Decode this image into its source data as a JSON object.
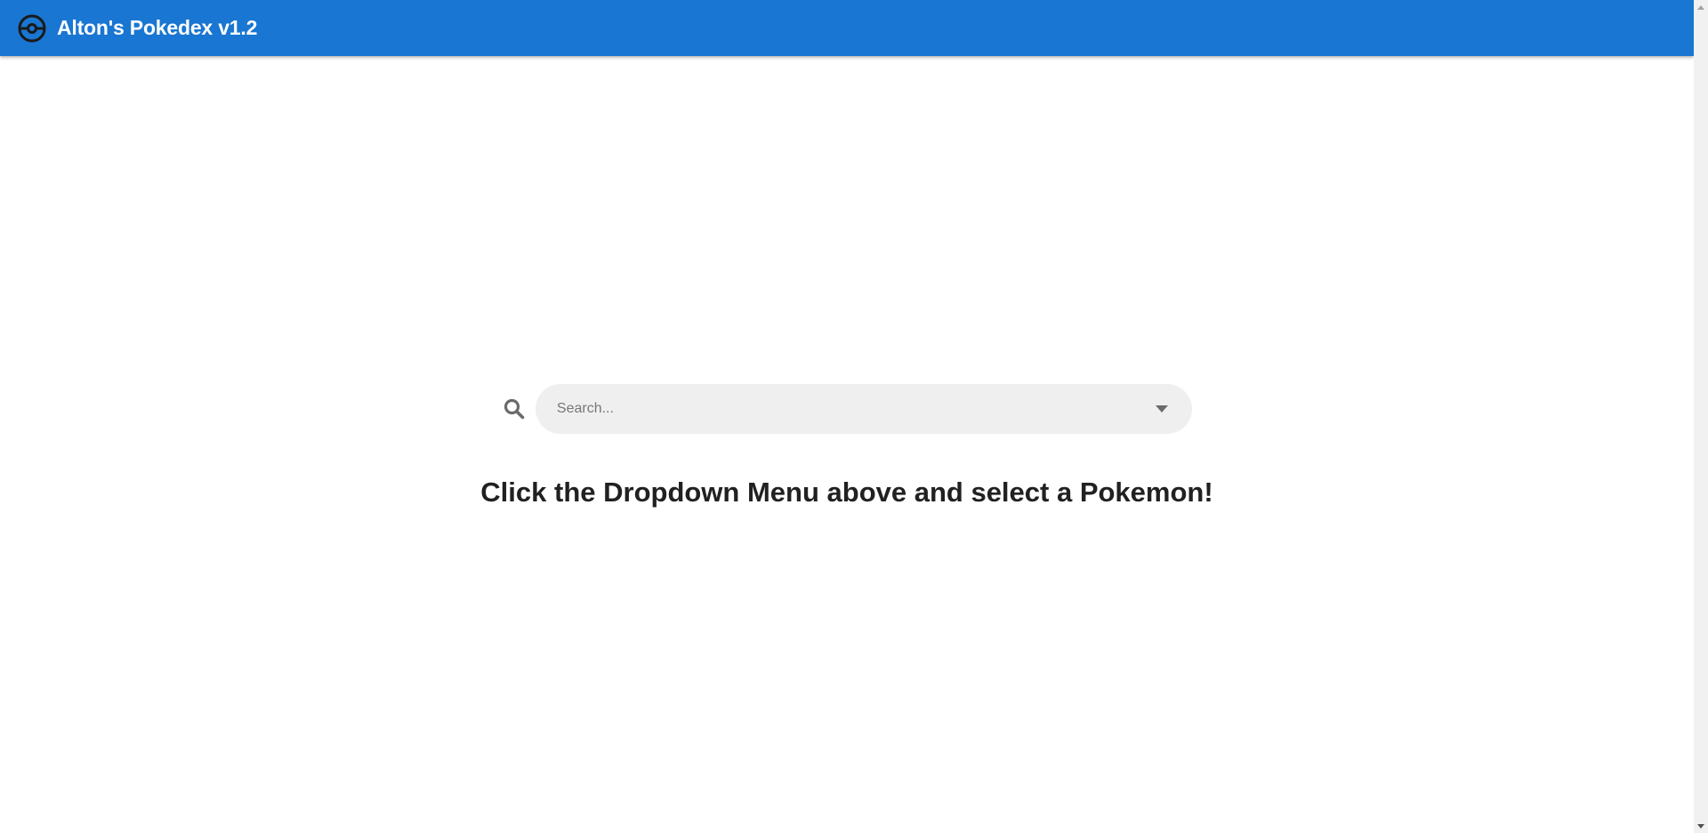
{
  "app": {
    "title": "Alton's Pokedex v1.2",
    "logo_icon": "pokeball-icon",
    "brand_color": "#1976d2"
  },
  "search": {
    "placeholder": "Search...",
    "value": "",
    "icon": "search-icon",
    "dropdown_icon": "caret-down-icon"
  },
  "main": {
    "prompt": "Click the Dropdown Menu above and select a Pokemon!"
  },
  "scrollbar": {
    "up_icon": "scroll-up-arrow-icon",
    "down_icon": "scroll-down-arrow-icon"
  }
}
